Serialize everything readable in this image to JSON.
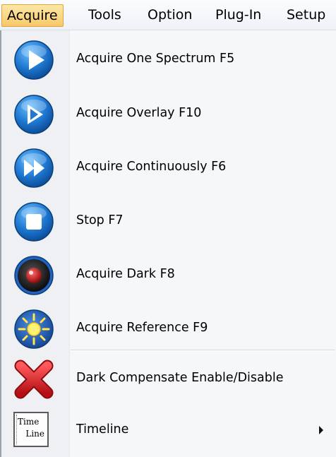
{
  "menubar": {
    "items": [
      {
        "label": "Acquire",
        "active": true
      },
      {
        "label": "Tools",
        "active": false
      },
      {
        "label": "Option",
        "active": false
      },
      {
        "label": "Plug-In",
        "active": false
      },
      {
        "label": "Setup",
        "active": false
      }
    ]
  },
  "menu": {
    "items": [
      {
        "label": "Acquire One Spectrum  F5",
        "icon": "play-icon"
      },
      {
        "label": "Acquire Overlay  F10",
        "icon": "play-overlay-icon"
      },
      {
        "label": "Acquire Continuously  F6",
        "icon": "fast-forward-icon"
      },
      {
        "label": "Stop  F7",
        "icon": "stop-icon"
      },
      {
        "label": "Acquire Dark  F8",
        "icon": "dark-lens-icon"
      },
      {
        "label": "Acquire Reference  F9",
        "icon": "sun-icon"
      },
      {
        "label": "Dark Compensate Enable/Disable",
        "icon": "red-x-icon"
      },
      {
        "label": "Timeline",
        "icon": "timeline-icon",
        "has_submenu": true
      }
    ],
    "timeline_icon_text": [
      "Time",
      "Line"
    ]
  },
  "colors": {
    "menubar_active_bg": "#f7c969",
    "menubar_active_border": "#e0a33b",
    "blue_button": "#1f78d1",
    "red_x": "#d9232a"
  }
}
